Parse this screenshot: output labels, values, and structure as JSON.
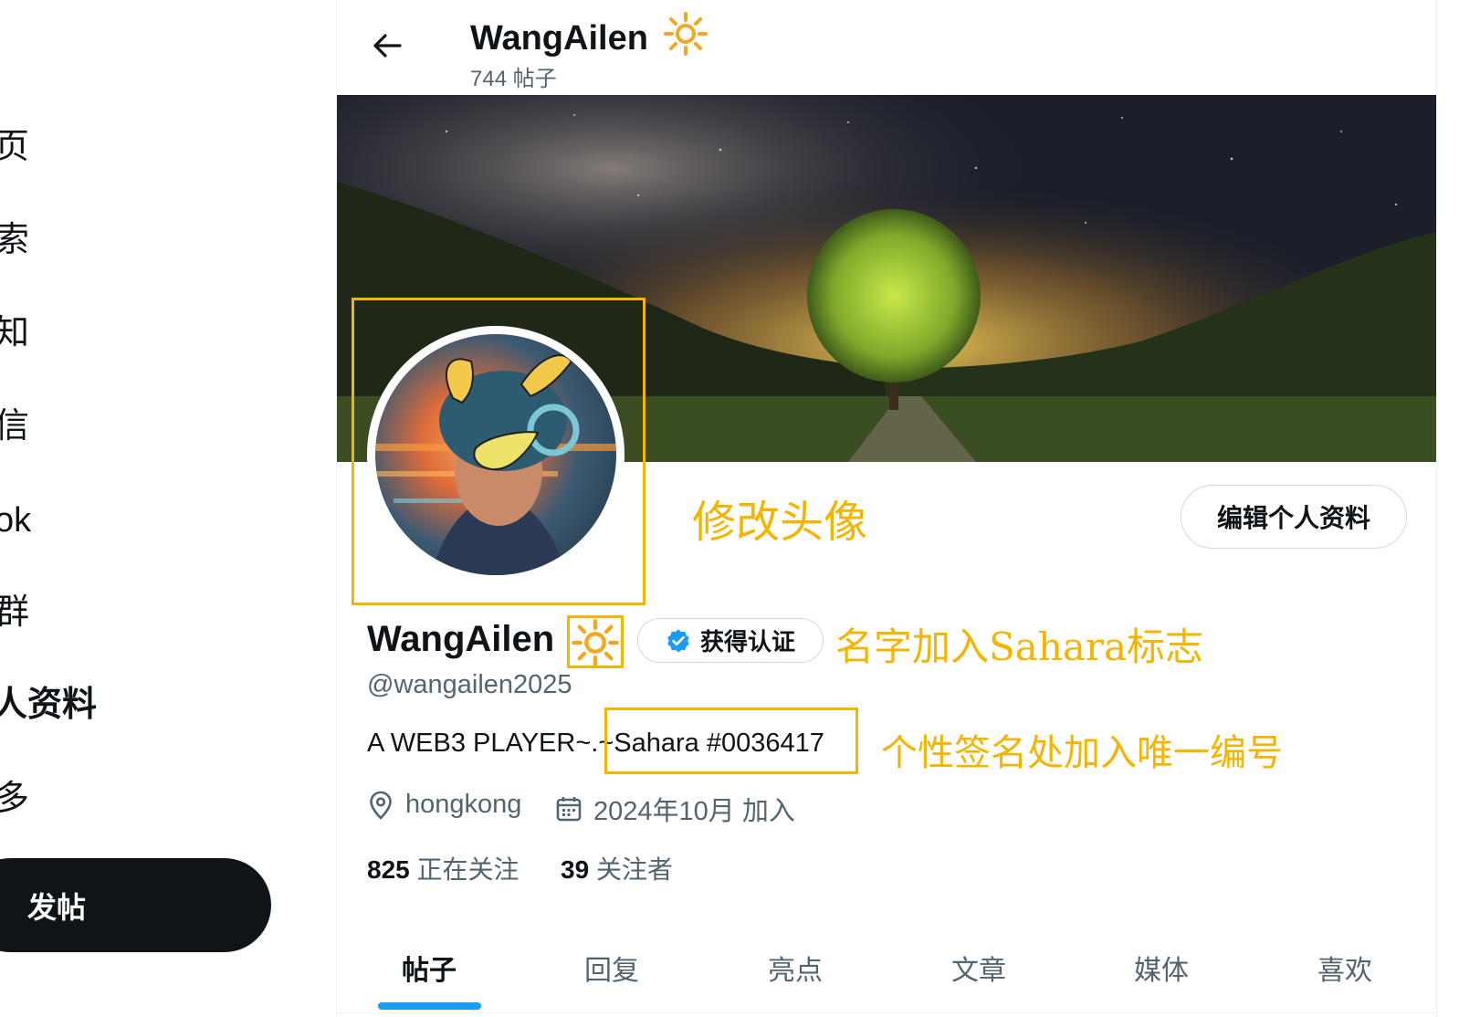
{
  "nav": {
    "items": [
      "页",
      "索",
      "知",
      "信",
      "ok",
      "群",
      "人资料",
      "多"
    ],
    "post_label": "发帖"
  },
  "header": {
    "title": "WangAilen",
    "post_count": "744 帖子"
  },
  "profile": {
    "display_name": "WangAilen",
    "verify_label": "获得认证",
    "handle": "@wangailen2025",
    "bio_prefix": "A WEB3 PLAYER~.~",
    "bio_sahara": "Sahara #0036417",
    "location": "hongkong",
    "joined": "2024年10月 加入",
    "following_count": "825",
    "following_label": "正在关注",
    "followers_count": "39",
    "followers_label": "关注者",
    "edit_label": "编辑个人资料"
  },
  "annotations": {
    "avatar": "修改头像",
    "name": "名字加入Sahara标志",
    "bio": "个性签名处加入唯一编号"
  },
  "tabs": [
    "帖子",
    "回复",
    "亮点",
    "文章",
    "媒体",
    "喜欢"
  ],
  "colors": {
    "accent": "#1d9bf0",
    "annotation": "#f5b400",
    "sun": "#f5a623"
  },
  "icons": [
    "back-arrow-icon",
    "sun-icon",
    "verified-check-icon",
    "location-pin-icon",
    "calendar-icon"
  ]
}
